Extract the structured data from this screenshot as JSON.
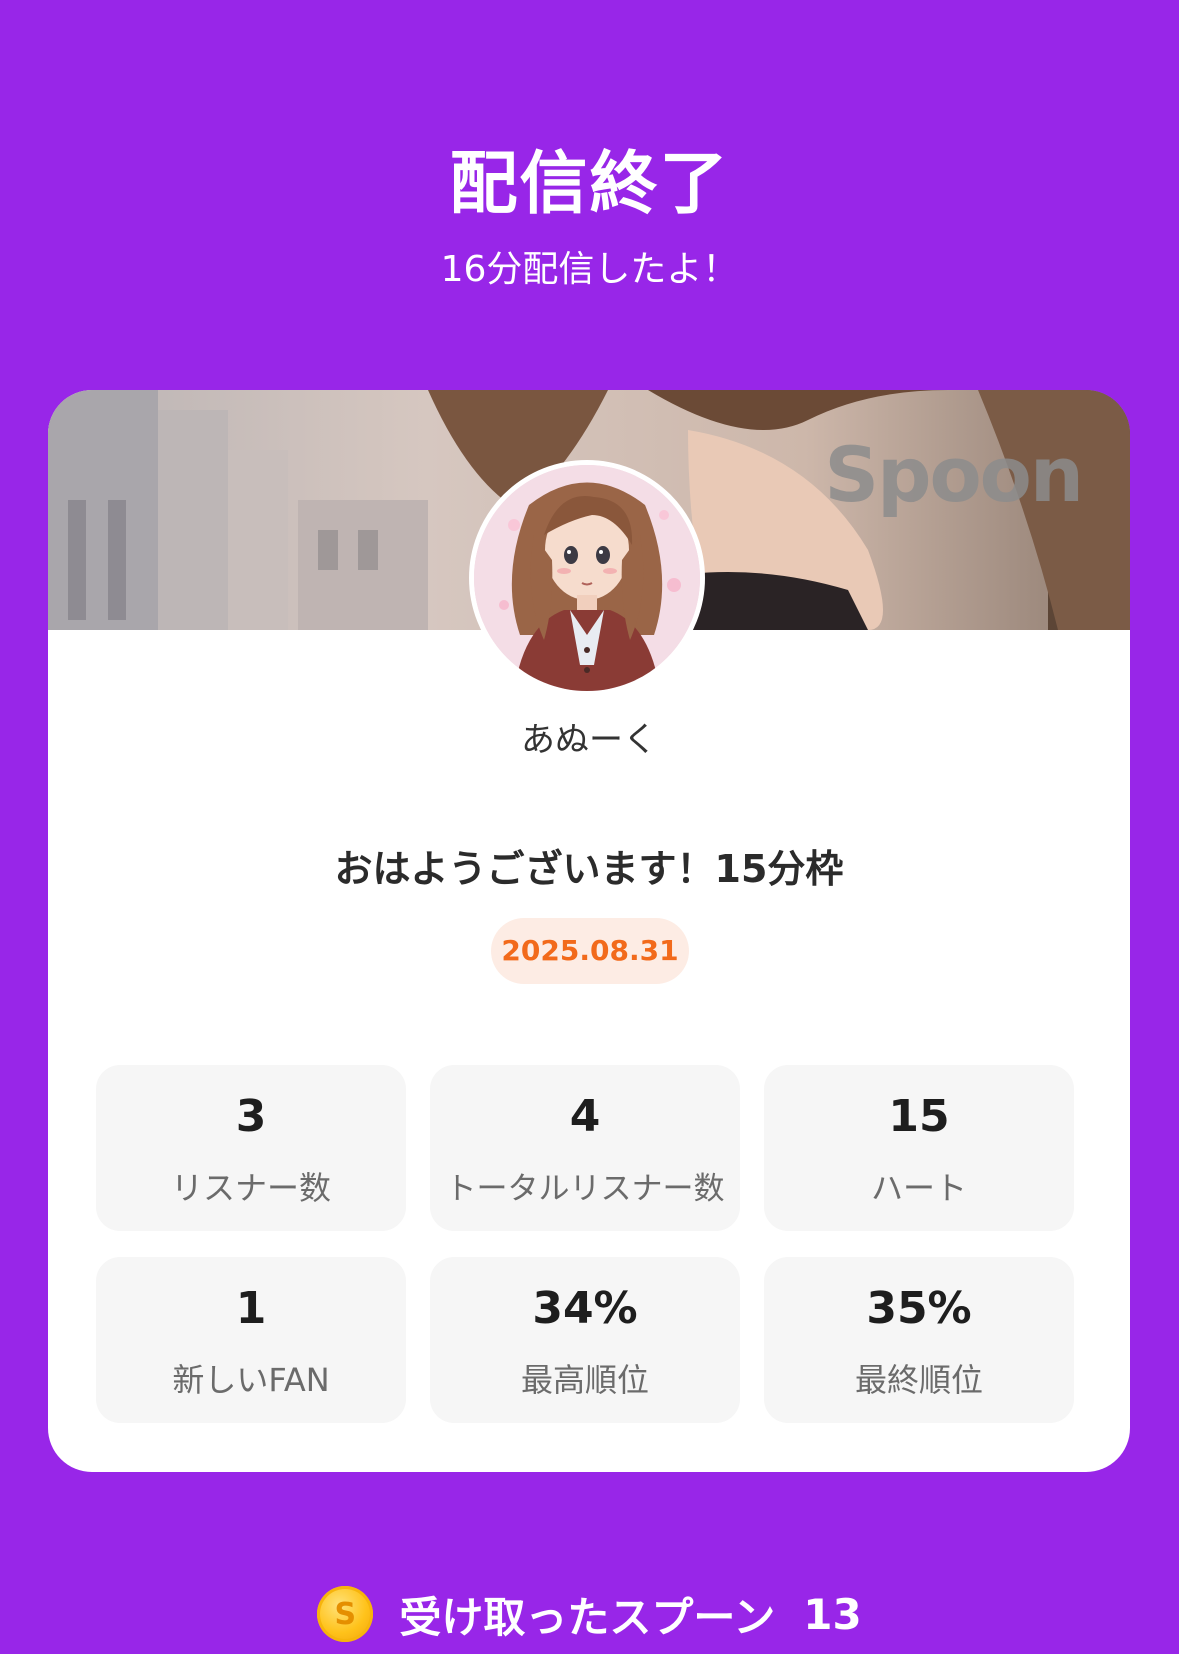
{
  "header": {
    "title": "配信終了",
    "subtitle": "16分配信したよ！"
  },
  "card": {
    "logo_text": "Spoon",
    "username": "あぬーく",
    "stream_title": "おはようございます！15分枠",
    "date": "2025.08.31",
    "stats": [
      {
        "value": "3",
        "label": "リスナー数"
      },
      {
        "value": "4",
        "label": "トータルリスナー数"
      },
      {
        "value": "15",
        "label": "ハート"
      },
      {
        "value": "1",
        "label": "新しいFAN"
      },
      {
        "value": "34%",
        "label": "最高順位"
      },
      {
        "value": "35%",
        "label": "最終順位"
      }
    ]
  },
  "spoons": {
    "label": "受け取ったスプーン",
    "count": "13",
    "coin_icon": "spoon-coin-icon",
    "coin_letter": "S"
  },
  "colors": {
    "background": "#9826e8",
    "card": "#ffffff",
    "date_badge_bg": "#fdece4",
    "date_text": "#f26a1b",
    "stat_tile": "#f6f6f6"
  }
}
